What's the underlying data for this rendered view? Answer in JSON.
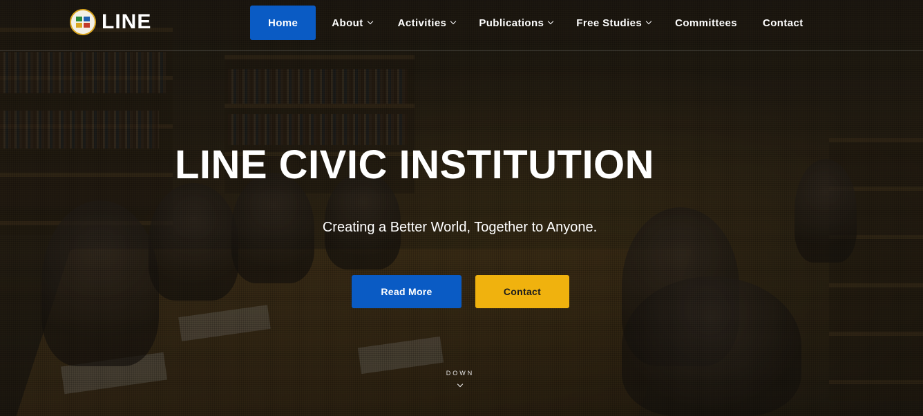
{
  "brand": {
    "name": "LINE",
    "logo_icon": "line-emblem-icon"
  },
  "nav": {
    "items": [
      {
        "label": "Home",
        "active": true,
        "has_dropdown": false
      },
      {
        "label": "About",
        "active": false,
        "has_dropdown": true
      },
      {
        "label": "Activities",
        "active": false,
        "has_dropdown": true
      },
      {
        "label": "Publications",
        "active": false,
        "has_dropdown": true
      },
      {
        "label": "Free Studies",
        "active": false,
        "has_dropdown": true
      },
      {
        "label": "Committees",
        "active": false,
        "has_dropdown": false
      },
      {
        "label": "Contact",
        "active": false,
        "has_dropdown": false
      }
    ]
  },
  "hero": {
    "title": "LINE CIVIC INSTITUTION",
    "subtitle": "Creating a Better World, Together to Anyone.",
    "primary_button": "Read More",
    "secondary_button": "Contact",
    "scroll_label": "DOWN"
  },
  "colors": {
    "accent_blue": "#0a5bc4",
    "accent_yellow": "#f0b20e",
    "text": "#ffffff"
  }
}
